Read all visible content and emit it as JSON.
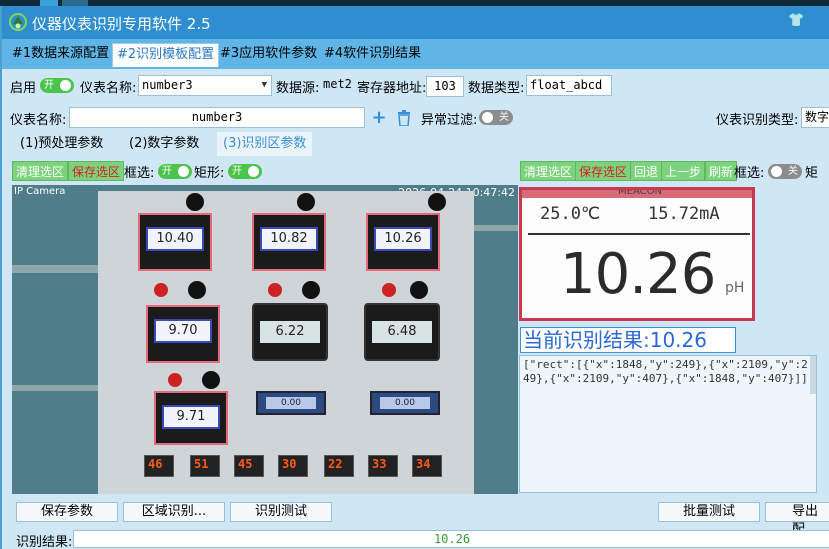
{
  "window": {
    "title": "仪器仪表识别专用软件 2.5"
  },
  "main_tabs": [
    {
      "label": "#1数据来源配置",
      "active": false
    },
    {
      "label": "#2识别模板配置",
      "active": true
    },
    {
      "label": "#3应用软件参数",
      "active": false
    },
    {
      "label": "#4软件识别结果",
      "active": false
    }
  ],
  "row1": {
    "enable_label": "启用",
    "enable_toggle": "开",
    "meter_name_label": "仪表名称:",
    "meter_name_value": "number3",
    "datasource_label": "数据源:",
    "datasource_value": "met2",
    "register_label": "寄存器地址:",
    "register_value": "103",
    "datatype_label": "数据类型:",
    "datatype_value": "float_abcd"
  },
  "row2": {
    "meter_name_label": "仪表名称:",
    "meter_name_value": "number3",
    "abnormal_filter_label": "异常过滤:",
    "abnormal_filter_toggle": "关",
    "recog_type_label": "仪表识别类型:",
    "recog_type_value": "数字"
  },
  "sub_tabs": [
    {
      "label": "(1)预处理参数",
      "active": false
    },
    {
      "label": "(2)数字参数",
      "active": false
    },
    {
      "label": "(3)识别区参数",
      "active": true
    }
  ],
  "left_tools": {
    "clear": "清理选区",
    "save": "保存选区",
    "boxsel_label": "框选:",
    "boxsel_toggle": "开",
    "rect_label": "矩形:",
    "rect_toggle": "开"
  },
  "right_tools": {
    "clear": "清理选区",
    "save": "保存选区",
    "revert": "回退",
    "prev": "上一步",
    "refresh": "刷新",
    "boxsel_label": "框选:",
    "boxsel_toggle": "关",
    "rect_label": "矩"
  },
  "camera": {
    "label": "IP Camera",
    "timestamp": "2026-04-24 10:47:42",
    "red_meters": [
      "10.40",
      "10.82",
      "10.26",
      "9.70",
      "9.71"
    ],
    "round_meters": [
      "6.22",
      "6.48"
    ],
    "blue_meters": [
      "0.00",
      "0.00"
    ],
    "leds": [
      "46",
      "51",
      "45",
      "30",
      "22",
      "33",
      "34"
    ]
  },
  "crop": {
    "top_label": "MEACON",
    "small_left": "25.0℃",
    "small_right": "15.72mA",
    "big_value": "10.26",
    "unit": "pH"
  },
  "current_result": "当前识别结果:10.26",
  "coords_json": "[\"rect\":[{\"x\":1848,\"y\":249},{\"x\":2109,\"y\":249},{\"x\":2109,\"y\":407},{\"x\":1848,\"y\":407}]]",
  "bottom_buttons": {
    "save_params": "保存参数",
    "region_recog": "区域识别...",
    "recog_test": "识别测试",
    "batch_test": "批量测试",
    "export": "导出配"
  },
  "result": {
    "label": "识别结果:",
    "value": "10.26"
  }
}
